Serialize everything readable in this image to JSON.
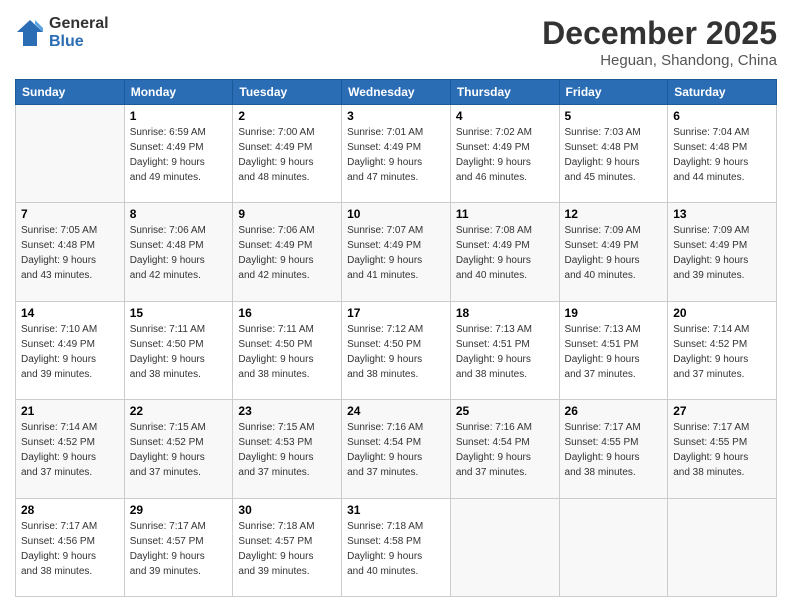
{
  "header": {
    "logo_line1": "General",
    "logo_line2": "Blue",
    "month": "December 2025",
    "location": "Heguan, Shandong, China"
  },
  "days_of_week": [
    "Sunday",
    "Monday",
    "Tuesday",
    "Wednesday",
    "Thursday",
    "Friday",
    "Saturday"
  ],
  "weeks": [
    [
      {
        "day": "",
        "info": ""
      },
      {
        "day": "1",
        "info": "Sunrise: 6:59 AM\nSunset: 4:49 PM\nDaylight: 9 hours\nand 49 minutes."
      },
      {
        "day": "2",
        "info": "Sunrise: 7:00 AM\nSunset: 4:49 PM\nDaylight: 9 hours\nand 48 minutes."
      },
      {
        "day": "3",
        "info": "Sunrise: 7:01 AM\nSunset: 4:49 PM\nDaylight: 9 hours\nand 47 minutes."
      },
      {
        "day": "4",
        "info": "Sunrise: 7:02 AM\nSunset: 4:49 PM\nDaylight: 9 hours\nand 46 minutes."
      },
      {
        "day": "5",
        "info": "Sunrise: 7:03 AM\nSunset: 4:48 PM\nDaylight: 9 hours\nand 45 minutes."
      },
      {
        "day": "6",
        "info": "Sunrise: 7:04 AM\nSunset: 4:48 PM\nDaylight: 9 hours\nand 44 minutes."
      }
    ],
    [
      {
        "day": "7",
        "info": "Sunrise: 7:05 AM\nSunset: 4:48 PM\nDaylight: 9 hours\nand 43 minutes."
      },
      {
        "day": "8",
        "info": "Sunrise: 7:06 AM\nSunset: 4:48 PM\nDaylight: 9 hours\nand 42 minutes."
      },
      {
        "day": "9",
        "info": "Sunrise: 7:06 AM\nSunset: 4:49 PM\nDaylight: 9 hours\nand 42 minutes."
      },
      {
        "day": "10",
        "info": "Sunrise: 7:07 AM\nSunset: 4:49 PM\nDaylight: 9 hours\nand 41 minutes."
      },
      {
        "day": "11",
        "info": "Sunrise: 7:08 AM\nSunset: 4:49 PM\nDaylight: 9 hours\nand 40 minutes."
      },
      {
        "day": "12",
        "info": "Sunrise: 7:09 AM\nSunset: 4:49 PM\nDaylight: 9 hours\nand 40 minutes."
      },
      {
        "day": "13",
        "info": "Sunrise: 7:09 AM\nSunset: 4:49 PM\nDaylight: 9 hours\nand 39 minutes."
      }
    ],
    [
      {
        "day": "14",
        "info": "Sunrise: 7:10 AM\nSunset: 4:49 PM\nDaylight: 9 hours\nand 39 minutes."
      },
      {
        "day": "15",
        "info": "Sunrise: 7:11 AM\nSunset: 4:50 PM\nDaylight: 9 hours\nand 38 minutes."
      },
      {
        "day": "16",
        "info": "Sunrise: 7:11 AM\nSunset: 4:50 PM\nDaylight: 9 hours\nand 38 minutes."
      },
      {
        "day": "17",
        "info": "Sunrise: 7:12 AM\nSunset: 4:50 PM\nDaylight: 9 hours\nand 38 minutes."
      },
      {
        "day": "18",
        "info": "Sunrise: 7:13 AM\nSunset: 4:51 PM\nDaylight: 9 hours\nand 38 minutes."
      },
      {
        "day": "19",
        "info": "Sunrise: 7:13 AM\nSunset: 4:51 PM\nDaylight: 9 hours\nand 37 minutes."
      },
      {
        "day": "20",
        "info": "Sunrise: 7:14 AM\nSunset: 4:52 PM\nDaylight: 9 hours\nand 37 minutes."
      }
    ],
    [
      {
        "day": "21",
        "info": "Sunrise: 7:14 AM\nSunset: 4:52 PM\nDaylight: 9 hours\nand 37 minutes."
      },
      {
        "day": "22",
        "info": "Sunrise: 7:15 AM\nSunset: 4:52 PM\nDaylight: 9 hours\nand 37 minutes."
      },
      {
        "day": "23",
        "info": "Sunrise: 7:15 AM\nSunset: 4:53 PM\nDaylight: 9 hours\nand 37 minutes."
      },
      {
        "day": "24",
        "info": "Sunrise: 7:16 AM\nSunset: 4:54 PM\nDaylight: 9 hours\nand 37 minutes."
      },
      {
        "day": "25",
        "info": "Sunrise: 7:16 AM\nSunset: 4:54 PM\nDaylight: 9 hours\nand 37 minutes."
      },
      {
        "day": "26",
        "info": "Sunrise: 7:17 AM\nSunset: 4:55 PM\nDaylight: 9 hours\nand 38 minutes."
      },
      {
        "day": "27",
        "info": "Sunrise: 7:17 AM\nSunset: 4:55 PM\nDaylight: 9 hours\nand 38 minutes."
      }
    ],
    [
      {
        "day": "28",
        "info": "Sunrise: 7:17 AM\nSunset: 4:56 PM\nDaylight: 9 hours\nand 38 minutes."
      },
      {
        "day": "29",
        "info": "Sunrise: 7:17 AM\nSunset: 4:57 PM\nDaylight: 9 hours\nand 39 minutes."
      },
      {
        "day": "30",
        "info": "Sunrise: 7:18 AM\nSunset: 4:57 PM\nDaylight: 9 hours\nand 39 minutes."
      },
      {
        "day": "31",
        "info": "Sunrise: 7:18 AM\nSunset: 4:58 PM\nDaylight: 9 hours\nand 40 minutes."
      },
      {
        "day": "",
        "info": ""
      },
      {
        "day": "",
        "info": ""
      },
      {
        "day": "",
        "info": ""
      }
    ]
  ]
}
